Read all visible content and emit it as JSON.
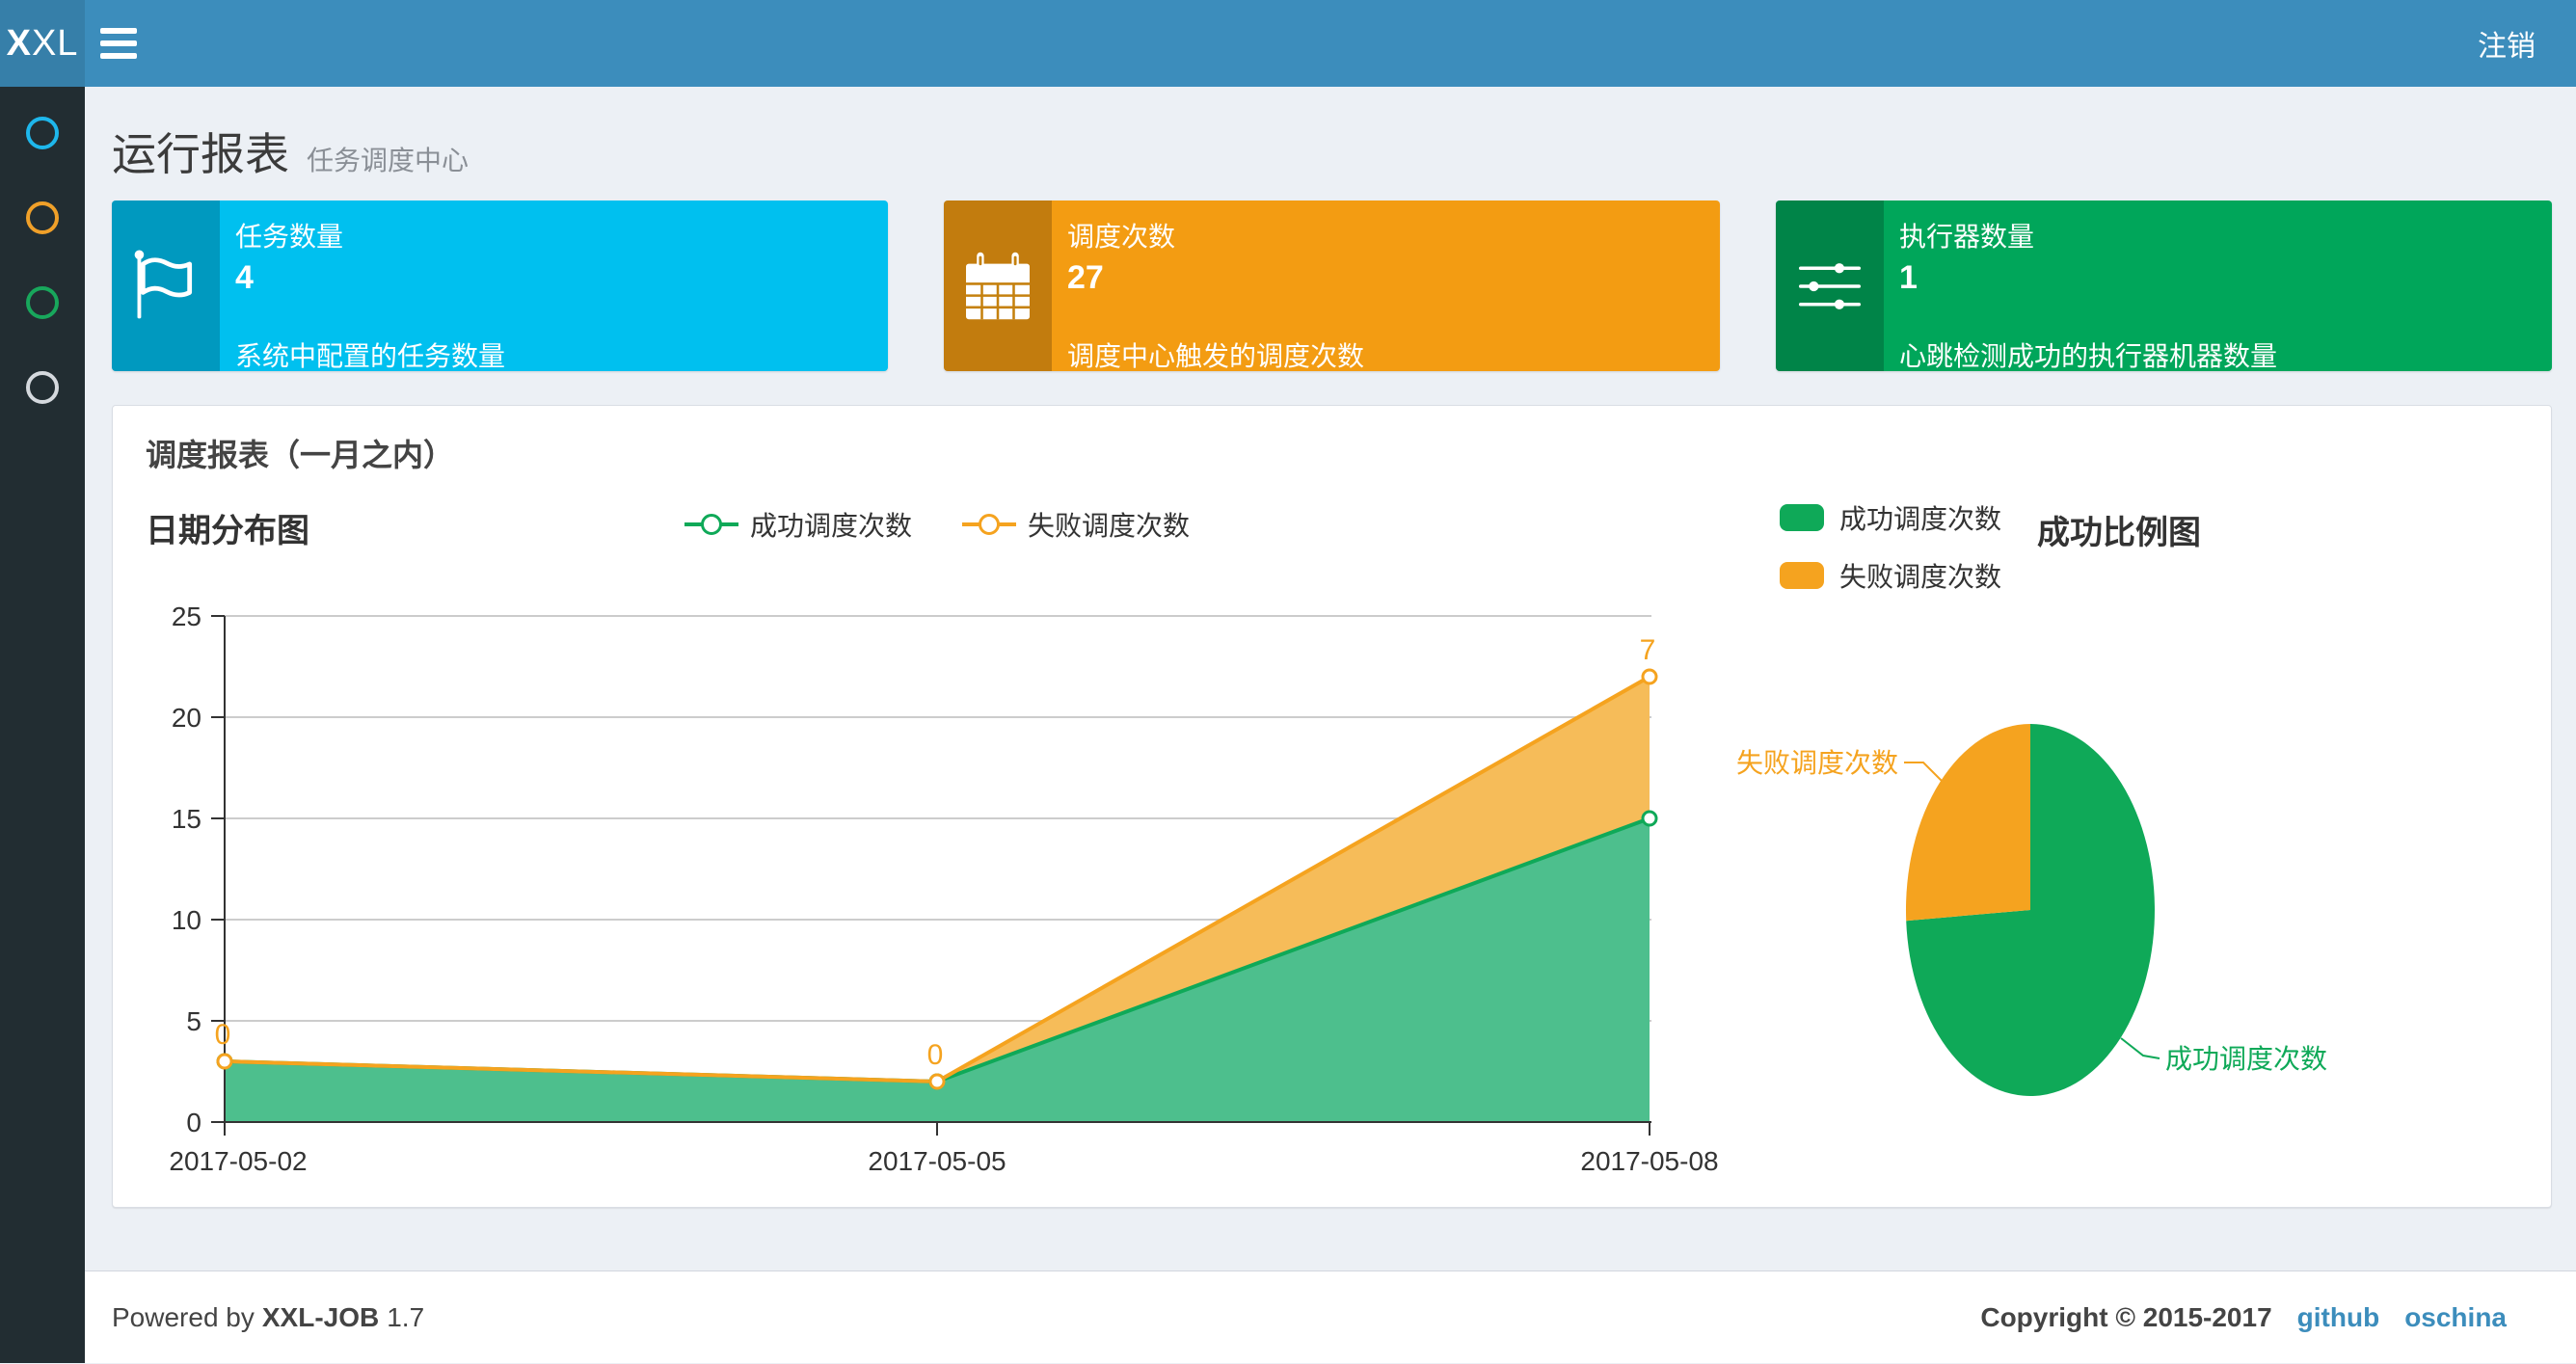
{
  "navbar": {
    "logo_bold": "X",
    "logo_rest": "XL",
    "logout_label": "注销"
  },
  "sidebar": {
    "items": [
      {
        "name": "menu-dashboard",
        "color": "#1eb7ec"
      },
      {
        "name": "menu-jobs",
        "color": "#f0a029"
      },
      {
        "name": "menu-executors",
        "color": "#18a75c"
      },
      {
        "name": "menu-logs",
        "color": "#d5d9de"
      }
    ]
  },
  "page_header": {
    "title": "运行报表",
    "subtitle": "任务调度中心"
  },
  "info_boxes": [
    {
      "label": "任务数量",
      "value": "4",
      "desc": "系统中配置的任务数量",
      "color": "#00c0ef",
      "icon": "flag-icon"
    },
    {
      "label": "调度次数",
      "value": "27",
      "desc": "调度中心触发的调度次数",
      "color": "#f39c12",
      "icon": "calendar-icon"
    },
    {
      "label": "执行器数量",
      "value": "1",
      "desc": "心跳检测成功的执行器机器数量",
      "color": "#00a65a",
      "icon": "sliders-icon"
    }
  ],
  "panel": {
    "title": "调度报表（一月之内）"
  },
  "chart_data": [
    {
      "type": "area",
      "title": "日期分布图",
      "categories": [
        "2017-05-02",
        "2017-05-05",
        "2017-05-08"
      ],
      "series": [
        {
          "name": "成功调度次数",
          "values": [
            3,
            2,
            15
          ],
          "color": "#0fa958",
          "fill": "#4dbf8d"
        },
        {
          "name": "失败调度次数",
          "values": [
            0,
            0,
            7
          ],
          "stacked": true,
          "data_labels": [
            "0",
            "0",
            "7"
          ],
          "color": "#f5a31f",
          "fill": "#f6bc59"
        }
      ],
      "ylabel": "",
      "xlabel": "",
      "ylim": [
        0,
        25
      ],
      "yticks": [
        "0",
        "5",
        "10",
        "15",
        "20",
        "25"
      ],
      "grid": true,
      "legend_position": "top-center"
    },
    {
      "type": "pie",
      "title": "成功比例图",
      "slices": [
        {
          "name": "成功调度次数",
          "value": 20,
          "color": "#0fa958"
        },
        {
          "name": "失败调度次数",
          "value": 7,
          "color": "#f5a31f"
        }
      ],
      "legend_position": "top-left"
    }
  ],
  "footer": {
    "powered_prefix": "Powered by",
    "product": "XXL-JOB",
    "version": "1.7",
    "copyright": "Copyright © 2015-2017",
    "links": [
      {
        "label": "github"
      },
      {
        "label": "oschina"
      }
    ]
  }
}
